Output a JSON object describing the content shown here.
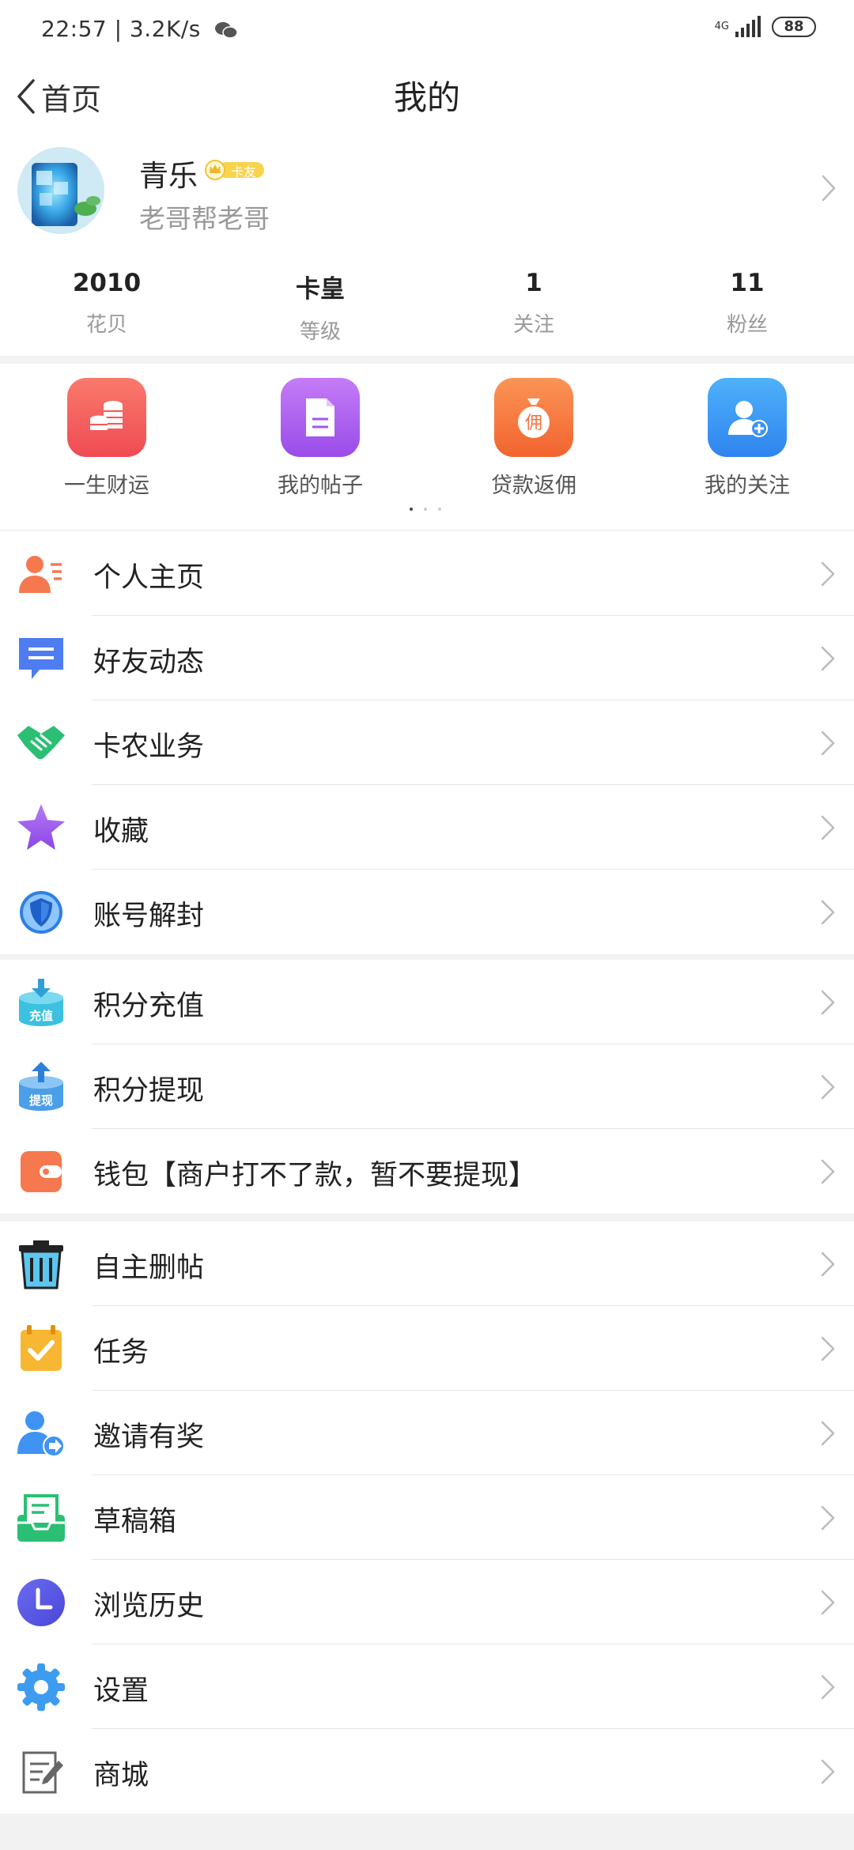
{
  "status": {
    "time_speed": "22:57 | 3.2K/s",
    "network": "4G",
    "battery": "88"
  },
  "nav": {
    "back_label": "首页",
    "title": "我的"
  },
  "profile": {
    "name": "青乐",
    "badge": "卡友",
    "subtitle": "老哥帮老哥"
  },
  "stats": [
    {
      "value": "2010",
      "label": "花贝"
    },
    {
      "value": "卡皇",
      "label": "等级"
    },
    {
      "value": "1",
      "label": "关注"
    },
    {
      "value": "11",
      "label": "粉丝"
    }
  ],
  "quick_actions": [
    {
      "label": "一生财运",
      "icon": "coins-icon",
      "color": "#f45a5a"
    },
    {
      "label": "我的帖子",
      "icon": "document-icon",
      "color": "#a257ec"
    },
    {
      "label": "贷款返佣",
      "icon": "money-bag-icon",
      "color": "#f5733c"
    },
    {
      "label": "我的关注",
      "icon": "add-user-icon",
      "color": "#3f93f3"
    }
  ],
  "menu_groups": [
    [
      {
        "label": "个人主页",
        "icon": "person-card-icon"
      },
      {
        "label": "好友动态",
        "icon": "message-icon"
      },
      {
        "label": "卡农业务",
        "icon": "handshake-icon"
      },
      {
        "label": "收藏",
        "icon": "star-icon"
      },
      {
        "label": "账号解封",
        "icon": "shield-icon"
      }
    ],
    [
      {
        "label": "积分充值",
        "icon": "recharge-icon"
      },
      {
        "label": "积分提现",
        "icon": "withdraw-icon"
      },
      {
        "label": "钱包【商户打不了款，暂不要提现】",
        "icon": "wallet-icon"
      }
    ],
    [
      {
        "label": "自主删帖",
        "icon": "trash-icon"
      },
      {
        "label": "任务",
        "icon": "task-icon"
      },
      {
        "label": "邀请有奖",
        "icon": "invite-icon"
      },
      {
        "label": "草稿箱",
        "icon": "drafts-icon"
      },
      {
        "label": "浏览历史",
        "icon": "clock-icon"
      },
      {
        "label": "设置",
        "icon": "gear-icon"
      },
      {
        "label": "商城",
        "icon": "mall-icon"
      }
    ]
  ],
  "badges": {
    "recharge": "充值",
    "withdraw": "提现"
  },
  "colors": {
    "accent_red": "#f45a5a",
    "accent_purple": "#a257ec",
    "accent_orange": "#f5733c",
    "accent_blue": "#3f93f3"
  }
}
